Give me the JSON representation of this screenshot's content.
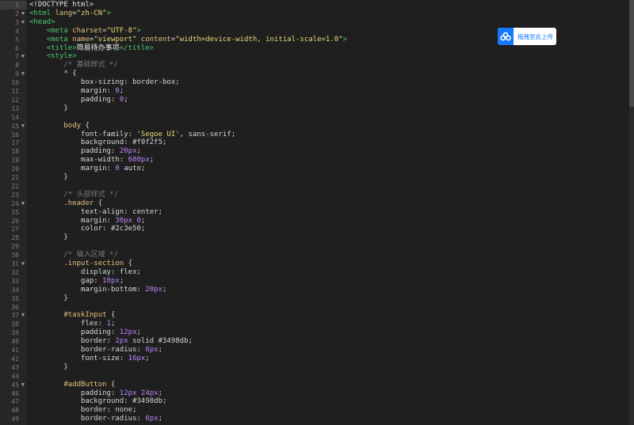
{
  "upload_button": {
    "label": "拖拽至此上传",
    "icon": "cloud-icon"
  },
  "colors": {
    "background": "#1f1f1f",
    "tag": "#4ec96c",
    "string": "#e6db74",
    "selector": "#e5c07b",
    "number": "#c084fc",
    "comment": "#7a7a7a",
    "accent": "#1677ff"
  },
  "current_line": 1,
  "lines": [
    {
      "n": "1",
      "fold": "",
      "tokens": [
        [
          "t-doc",
          "<!DOCTYPE html>"
        ]
      ]
    },
    {
      "n": "2",
      "fold": "▼",
      "tokens": [
        [
          "t-tag",
          "<html "
        ],
        [
          "t-attr",
          "lang"
        ],
        [
          "t-p",
          "="
        ],
        [
          "t-str",
          "\"zh-CN\""
        ],
        [
          "t-tag",
          ">"
        ]
      ]
    },
    {
      "n": "3",
      "fold": "▼",
      "tokens": [
        [
          "t-tag",
          "<head>"
        ]
      ]
    },
    {
      "n": "4",
      "fold": "",
      "tokens": [
        [
          "t-p",
          "    "
        ],
        [
          "t-tag",
          "<meta "
        ],
        [
          "t-attr",
          "charset"
        ],
        [
          "t-p",
          "="
        ],
        [
          "t-str",
          "\"UTF-8\""
        ],
        [
          "t-tag",
          ">"
        ]
      ]
    },
    {
      "n": "5",
      "fold": "",
      "tokens": [
        [
          "t-p",
          "    "
        ],
        [
          "t-tag",
          "<meta "
        ],
        [
          "t-attr",
          "name"
        ],
        [
          "t-p",
          "="
        ],
        [
          "t-str",
          "\"viewport\""
        ],
        [
          "t-p",
          " "
        ],
        [
          "t-attr",
          "content"
        ],
        [
          "t-p",
          "="
        ],
        [
          "t-str",
          "\"width=device-width, initial-scale=1.0\""
        ],
        [
          "t-tag",
          ">"
        ]
      ]
    },
    {
      "n": "6",
      "fold": "",
      "tokens": [
        [
          "t-p",
          "    "
        ],
        [
          "t-tag",
          "<title>"
        ],
        [
          "t-txt",
          "简易待办事项"
        ],
        [
          "t-tag",
          "</title>"
        ]
      ]
    },
    {
      "n": "7",
      "fold": "▼",
      "tokens": [
        [
          "t-p",
          "    "
        ],
        [
          "t-tag",
          "<style>"
        ]
      ]
    },
    {
      "n": "8",
      "fold": "",
      "tokens": [
        [
          "t-p",
          "        "
        ],
        [
          "t-com",
          "/* 基础样式 */"
        ]
      ]
    },
    {
      "n": "9",
      "fold": "▼",
      "tokens": [
        [
          "t-p",
          "        "
        ],
        [
          "t-sel",
          "* "
        ],
        [
          "t-p",
          "{"
        ]
      ]
    },
    {
      "n": "10",
      "fold": "",
      "tokens": [
        [
          "t-p",
          "            "
        ],
        [
          "t-prop",
          "box-sizing"
        ],
        [
          "t-p",
          ": "
        ],
        [
          "t-val",
          "border-box"
        ],
        [
          "t-p",
          ";"
        ]
      ]
    },
    {
      "n": "11",
      "fold": "",
      "tokens": [
        [
          "t-p",
          "            "
        ],
        [
          "t-prop",
          "margin"
        ],
        [
          "t-p",
          ": "
        ],
        [
          "t-num",
          "0"
        ],
        [
          "t-p",
          ";"
        ]
      ]
    },
    {
      "n": "12",
      "fold": "",
      "tokens": [
        [
          "t-p",
          "            "
        ],
        [
          "t-prop",
          "padding"
        ],
        [
          "t-p",
          ": "
        ],
        [
          "t-num",
          "0"
        ],
        [
          "t-p",
          ";"
        ]
      ]
    },
    {
      "n": "13",
      "fold": "",
      "tokens": [
        [
          "t-p",
          "        }"
        ]
      ]
    },
    {
      "n": "14",
      "fold": "",
      "tokens": []
    },
    {
      "n": "15",
      "fold": "▼",
      "tokens": [
        [
          "t-p",
          "        "
        ],
        [
          "t-sel",
          "body "
        ],
        [
          "t-p",
          "{"
        ]
      ]
    },
    {
      "n": "16",
      "fold": "",
      "tokens": [
        [
          "t-p",
          "            "
        ],
        [
          "t-prop",
          "font-family"
        ],
        [
          "t-p",
          ": "
        ],
        [
          "t-str",
          "'Segoe UI'"
        ],
        [
          "t-p",
          ", "
        ],
        [
          "t-val",
          "sans-serif"
        ],
        [
          "t-p",
          ";"
        ]
      ]
    },
    {
      "n": "17",
      "fold": "",
      "tokens": [
        [
          "t-p",
          "            "
        ],
        [
          "t-prop",
          "background"
        ],
        [
          "t-p",
          ": "
        ],
        [
          "t-val",
          "#f0f2f5"
        ],
        [
          "t-p",
          ";"
        ]
      ]
    },
    {
      "n": "18",
      "fold": "",
      "tokens": [
        [
          "t-p",
          "            "
        ],
        [
          "t-prop",
          "padding"
        ],
        [
          "t-p",
          ": "
        ],
        [
          "t-num",
          "20px"
        ],
        [
          "t-p",
          ";"
        ]
      ]
    },
    {
      "n": "19",
      "fold": "",
      "tokens": [
        [
          "t-p",
          "            "
        ],
        [
          "t-prop",
          "max-width"
        ],
        [
          "t-p",
          ": "
        ],
        [
          "t-num",
          "600px"
        ],
        [
          "t-p",
          ";"
        ]
      ]
    },
    {
      "n": "20",
      "fold": "",
      "tokens": [
        [
          "t-p",
          "            "
        ],
        [
          "t-prop",
          "margin"
        ],
        [
          "t-p",
          ": "
        ],
        [
          "t-num",
          "0"
        ],
        [
          "t-p",
          " "
        ],
        [
          "t-val",
          "auto"
        ],
        [
          "t-p",
          ";"
        ]
      ]
    },
    {
      "n": "21",
      "fold": "",
      "tokens": [
        [
          "t-p",
          "        }"
        ]
      ]
    },
    {
      "n": "22",
      "fold": "",
      "tokens": []
    },
    {
      "n": "23",
      "fold": "",
      "tokens": [
        [
          "t-p",
          "        "
        ],
        [
          "t-com",
          "/* 头部样式 */"
        ]
      ]
    },
    {
      "n": "24",
      "fold": "▼",
      "tokens": [
        [
          "t-p",
          "        "
        ],
        [
          "t-sel",
          ".header "
        ],
        [
          "t-p",
          "{"
        ]
      ]
    },
    {
      "n": "25",
      "fold": "",
      "tokens": [
        [
          "t-p",
          "            "
        ],
        [
          "t-prop",
          "text-align"
        ],
        [
          "t-p",
          ": "
        ],
        [
          "t-val",
          "center"
        ],
        [
          "t-p",
          ";"
        ]
      ]
    },
    {
      "n": "26",
      "fold": "",
      "tokens": [
        [
          "t-p",
          "            "
        ],
        [
          "t-prop",
          "margin"
        ],
        [
          "t-p",
          ": "
        ],
        [
          "t-num",
          "30px"
        ],
        [
          "t-p",
          " "
        ],
        [
          "t-num",
          "0"
        ],
        [
          "t-p",
          ";"
        ]
      ]
    },
    {
      "n": "27",
      "fold": "",
      "tokens": [
        [
          "t-p",
          "            "
        ],
        [
          "t-prop",
          "color"
        ],
        [
          "t-p",
          ": "
        ],
        [
          "t-val",
          "#2c3e50"
        ],
        [
          "t-p",
          ";"
        ]
      ]
    },
    {
      "n": "28",
      "fold": "",
      "tokens": [
        [
          "t-p",
          "        }"
        ]
      ]
    },
    {
      "n": "29",
      "fold": "",
      "tokens": []
    },
    {
      "n": "30",
      "fold": "",
      "tokens": [
        [
          "t-p",
          "        "
        ],
        [
          "t-com",
          "/* 输入区域 */"
        ]
      ]
    },
    {
      "n": "31",
      "fold": "▼",
      "tokens": [
        [
          "t-p",
          "        "
        ],
        [
          "t-sel",
          ".input-section "
        ],
        [
          "t-p",
          "{"
        ]
      ]
    },
    {
      "n": "32",
      "fold": "",
      "tokens": [
        [
          "t-p",
          "            "
        ],
        [
          "t-prop",
          "display"
        ],
        [
          "t-p",
          ": "
        ],
        [
          "t-val",
          "flex"
        ],
        [
          "t-p",
          ";"
        ]
      ]
    },
    {
      "n": "33",
      "fold": "",
      "tokens": [
        [
          "t-p",
          "            "
        ],
        [
          "t-prop",
          "gap"
        ],
        [
          "t-p",
          ": "
        ],
        [
          "t-num",
          "10px"
        ],
        [
          "t-p",
          ";"
        ]
      ]
    },
    {
      "n": "34",
      "fold": "",
      "tokens": [
        [
          "t-p",
          "            "
        ],
        [
          "t-prop",
          "margin-bottom"
        ],
        [
          "t-p",
          ": "
        ],
        [
          "t-num",
          "20px"
        ],
        [
          "t-p",
          ";"
        ]
      ]
    },
    {
      "n": "35",
      "fold": "",
      "tokens": [
        [
          "t-p",
          "        }"
        ]
      ]
    },
    {
      "n": "36",
      "fold": "",
      "tokens": []
    },
    {
      "n": "37",
      "fold": "▼",
      "tokens": [
        [
          "t-p",
          "        "
        ],
        [
          "t-sel",
          "#taskInput "
        ],
        [
          "t-p",
          "{"
        ]
      ]
    },
    {
      "n": "38",
      "fold": "",
      "tokens": [
        [
          "t-p",
          "            "
        ],
        [
          "t-prop",
          "flex"
        ],
        [
          "t-p",
          ": "
        ],
        [
          "t-num",
          "1"
        ],
        [
          "t-p",
          ";"
        ]
      ]
    },
    {
      "n": "39",
      "fold": "",
      "tokens": [
        [
          "t-p",
          "            "
        ],
        [
          "t-prop",
          "padding"
        ],
        [
          "t-p",
          ": "
        ],
        [
          "t-num",
          "12px"
        ],
        [
          "t-p",
          ";"
        ]
      ]
    },
    {
      "n": "40",
      "fold": "",
      "tokens": [
        [
          "t-p",
          "            "
        ],
        [
          "t-prop",
          "border"
        ],
        [
          "t-p",
          ": "
        ],
        [
          "t-num",
          "2px"
        ],
        [
          "t-p",
          " "
        ],
        [
          "t-val",
          "solid #3498db"
        ],
        [
          "t-p",
          ";"
        ]
      ]
    },
    {
      "n": "41",
      "fold": "",
      "tokens": [
        [
          "t-p",
          "            "
        ],
        [
          "t-prop",
          "border-radius"
        ],
        [
          "t-p",
          ": "
        ],
        [
          "t-num",
          "6px"
        ],
        [
          "t-p",
          ";"
        ]
      ]
    },
    {
      "n": "42",
      "fold": "",
      "tokens": [
        [
          "t-p",
          "            "
        ],
        [
          "t-prop",
          "font-size"
        ],
        [
          "t-p",
          ": "
        ],
        [
          "t-num",
          "16px"
        ],
        [
          "t-p",
          ";"
        ]
      ]
    },
    {
      "n": "43",
      "fold": "",
      "tokens": [
        [
          "t-p",
          "        }"
        ]
      ]
    },
    {
      "n": "44",
      "fold": "",
      "tokens": []
    },
    {
      "n": "45",
      "fold": "▼",
      "tokens": [
        [
          "t-p",
          "        "
        ],
        [
          "t-sel",
          "#addButton "
        ],
        [
          "t-p",
          "{"
        ]
      ]
    },
    {
      "n": "46",
      "fold": "",
      "tokens": [
        [
          "t-p",
          "            "
        ],
        [
          "t-prop",
          "padding"
        ],
        [
          "t-p",
          ": "
        ],
        [
          "t-num",
          "12px"
        ],
        [
          "t-p",
          " "
        ],
        [
          "t-num",
          "24px"
        ],
        [
          "t-p",
          ";"
        ]
      ]
    },
    {
      "n": "47",
      "fold": "",
      "tokens": [
        [
          "t-p",
          "            "
        ],
        [
          "t-prop",
          "background"
        ],
        [
          "t-p",
          ": "
        ],
        [
          "t-val",
          "#3498db"
        ],
        [
          "t-p",
          ";"
        ]
      ]
    },
    {
      "n": "48",
      "fold": "",
      "tokens": [
        [
          "t-p",
          "            "
        ],
        [
          "t-prop",
          "border"
        ],
        [
          "t-p",
          ": "
        ],
        [
          "t-val",
          "none"
        ],
        [
          "t-p",
          ";"
        ]
      ]
    },
    {
      "n": "49",
      "fold": "",
      "tokens": [
        [
          "t-p",
          "            "
        ],
        [
          "t-prop",
          "border-radius"
        ],
        [
          "t-p",
          ": "
        ],
        [
          "t-num",
          "6px"
        ],
        [
          "t-p",
          ";"
        ]
      ]
    }
  ]
}
